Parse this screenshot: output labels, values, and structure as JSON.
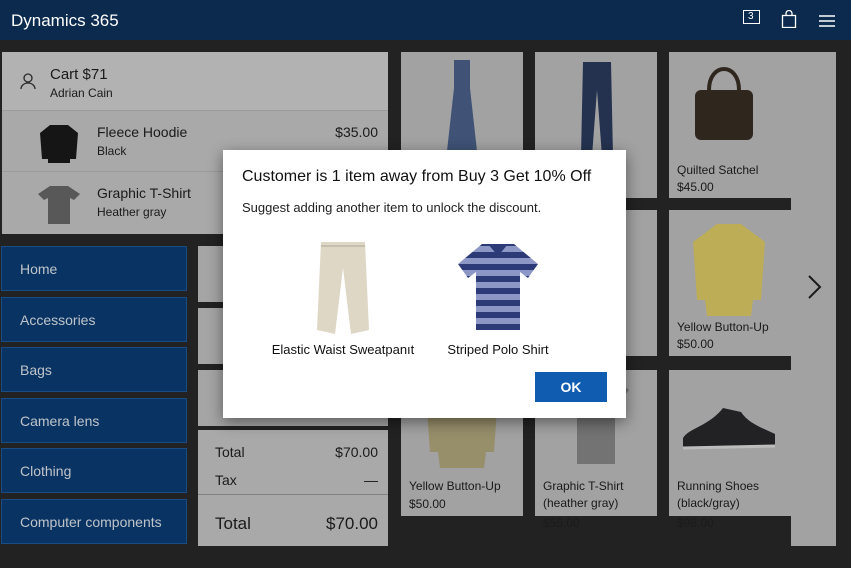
{
  "app": {
    "title": "Dynamics 365",
    "badge_count": "3"
  },
  "cart": {
    "title": "Cart $71",
    "customer": "Adrian Cain",
    "lines": [
      {
        "name": "Fleece Hoodie",
        "variant": "Black",
        "price": "$35.00"
      },
      {
        "name": "Graphic T-Shirt",
        "variant": "Heather gray",
        "price": ""
      }
    ]
  },
  "categories": [
    "Home",
    "Accessories",
    "Bags",
    "Camera lens",
    "Clothing",
    "Computer components"
  ],
  "totals": {
    "total_label": "Total",
    "total_value": "$70.00",
    "tax_label": "Tax",
    "tax_value": "—",
    "grand_label": "Total",
    "grand_value": "$70.00"
  },
  "products": [
    {
      "name": "Quilted Satchel",
      "price": "$45.00"
    },
    {
      "name": "Yellow Button-Up",
      "price": "$50.00"
    },
    {
      "name": "Yellow Button-Up",
      "price": "$50.00"
    },
    {
      "name": "Graphic T-Shirt (heather gray)",
      "price": "$55.00"
    },
    {
      "name": "Running Shoes (black/gray)",
      "price": "$98.00"
    }
  ],
  "dialog": {
    "title": "Customer is 1 item away from Buy 3 Get 10% Off",
    "message": "Suggest adding another item to unlock the discount.",
    "suggestions": [
      {
        "name": "Elastic Waist Sweatpanıt"
      },
      {
        "name": "Striped Polo Shirt"
      }
    ],
    "ok_label": "OK"
  }
}
